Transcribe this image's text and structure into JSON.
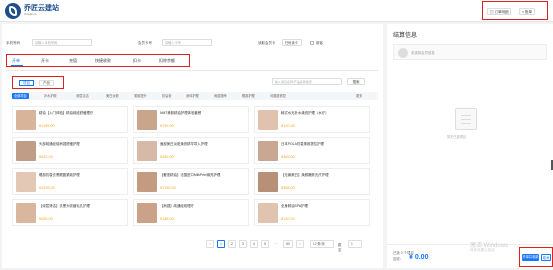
{
  "header": {
    "brand_name": "乔匠云建站",
    "brand_sub": "xmsqk.cn",
    "actions": [
      "订单明细",
      "账单"
    ]
  },
  "filters": {
    "phone_label": "手机号码",
    "phone_placeholder": "请输入手机号码",
    "card_label": "会员卡号",
    "card_placeholder": "请输入卡号",
    "read_card_label": "读取会员卡",
    "read_card_button": "扫码读卡",
    "new_label": "新客"
  },
  "tabs": [
    "开单",
    "开卡",
    "充值",
    "快捷收款",
    "扣卡",
    "扣除余额"
  ],
  "active_tab": 0,
  "segments": [
    "项目",
    "产品"
  ],
  "product_search_placeholder": "输入项目名称/产品名称搜索",
  "search_button": "搜索",
  "categories": [
    "全部项目",
    "补水护肤",
    "深层清洁",
    "美白淡斑",
    "紧致提升",
    "抗衰老",
    "身体护理",
    "肩颈按摩",
    "眼部护理",
    "问题肌修复",
    "更多"
  ],
  "products": [
    {
      "name": "精油【入门体验】精油疏经舒缓理疗",
      "price": "¥1199.00",
      "thumb_color": "#d8b49a"
    },
    {
      "name": "NMT美肤精油护理体验套餐",
      "price": "¥799.00",
      "thumb_color": "#c9a58c"
    },
    {
      "name": "韩式水光补水焕亮护理（水疗）",
      "price": "¥120.00",
      "thumb_color": "#e0c2ae"
    },
    {
      "name": "头部疏通经络肩颈舒缓护理",
      "price": "¥420.00",
      "thumb_color": "#bf9d86"
    },
    {
      "name": "面部美白淡斑焕亮精华导入护理",
      "price": "¥165.00",
      "thumb_color": "#d6b9a6"
    },
    {
      "name": "日本POLA抗衰紧致提拉护理",
      "price": "¥465.00",
      "thumb_color": "#caa792"
    },
    {
      "name": "眼部抗衰去黑眼圈紧致护理",
      "price": "¥1299.00",
      "thumb_color": "#e3c8b6"
    },
    {
      "name": "【奢宠精油】法国进口MilkPeel焕亮护理",
      "price": "¥1780.00",
      "thumb_color": "#c49b80"
    },
    {
      "name": "【无痛美白】焕颜嫩肤光疗护理",
      "price": "¥358.00",
      "thumb_color": "#b89078"
    },
    {
      "name": "【深层清洁】去黑头收缩毛孔护理",
      "price": "¥265.00",
      "thumb_color": "#d9b79f"
    },
    {
      "name": "【肩颈】疏通经络理疗",
      "price": "¥188.00",
      "thumb_color": "#caa28a"
    },
    {
      "name": "全身精油SPA护理",
      "price": "¥120.00",
      "thumb_color": "#e1c4b0"
    }
  ],
  "pagination": {
    "prev": "‹",
    "pages": [
      "1",
      "2",
      "3",
      "4",
      "5",
      "…",
      "50"
    ],
    "next": "›",
    "page_size": "12 条/页",
    "goto_label": "跳至",
    "goto_value": "1"
  },
  "side": {
    "title": "结算信息",
    "member_placeholder": "未选择会员信息",
    "empty_text": "暂无已选项目"
  },
  "footer": {
    "count_text": "已选 0 个项目",
    "total_label": "应收：",
    "total_value": "¥ 0.00",
    "settle_button": "开单并收款",
    "cancel_button": "取消"
  },
  "watermark": {
    "line1": "激活 Windows",
    "line2": "转到设置以激活"
  },
  "colors": {
    "accent": "#1677ff",
    "price": "#f5a623",
    "highlight": "#e02020",
    "brand": "#1f4e8c"
  }
}
